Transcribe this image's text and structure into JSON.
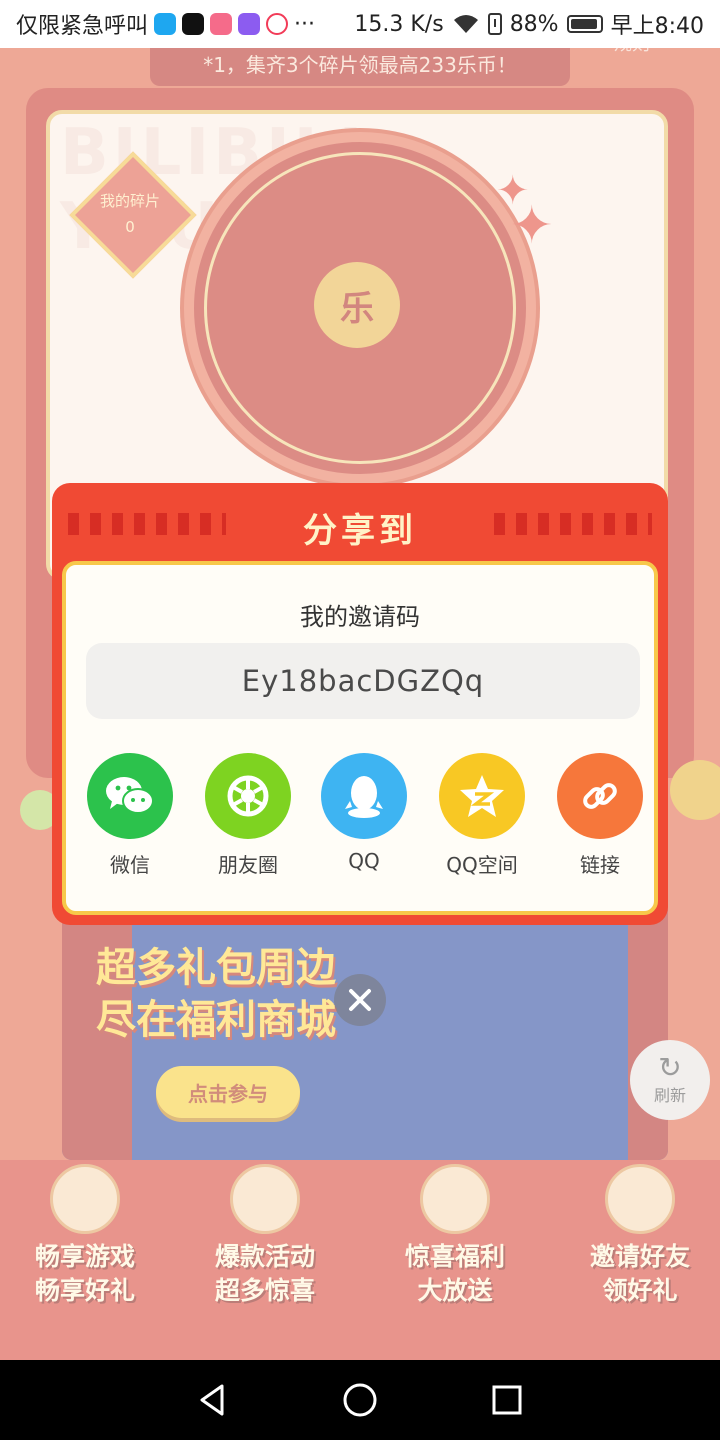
{
  "status_bar": {
    "carrier": "仅限紧急呼叫",
    "more": "···",
    "speed": "15.3 K/s",
    "battery": "88%",
    "time": "早上8:40"
  },
  "background": {
    "banner_text": "*1，集齐3个碎片领最高233乐币！",
    "rules_link": "规则",
    "watermark": "BILIBILI YOUXUAN",
    "shard_label": "我的碎片",
    "shard_count": "0",
    "wheel_center": "乐",
    "promo_title_1": "超多礼包周边",
    "promo_title_2": "尽在福利商城",
    "promo_button": "点击参与",
    "refresh_label": "刷新",
    "bottom_items": [
      {
        "line1": "畅享游戏",
        "line2": "畅享好礼"
      },
      {
        "line1": "爆款活动",
        "line2": "超多惊喜"
      },
      {
        "line1": "惊喜福利",
        "line2": "大放送"
      },
      {
        "line1": "邀请好友",
        "line2": "领好礼"
      }
    ]
  },
  "dialog": {
    "title": "分享到",
    "invite_label": "我的邀请码",
    "invite_code": "Ey18bacDGZQq",
    "share_options": [
      {
        "label": "微信",
        "color": "#2cc24c",
        "icon": "wechat-icon"
      },
      {
        "label": "朋友圈",
        "color": "#7ed321",
        "icon": "moments-icon"
      },
      {
        "label": "QQ",
        "color": "#3eb4f2",
        "icon": "qq-icon"
      },
      {
        "label": "QQ空间",
        "color": "#f8c824",
        "icon": "qzone-icon"
      },
      {
        "label": "链接",
        "color": "#f6773b",
        "icon": "link-icon"
      }
    ]
  }
}
